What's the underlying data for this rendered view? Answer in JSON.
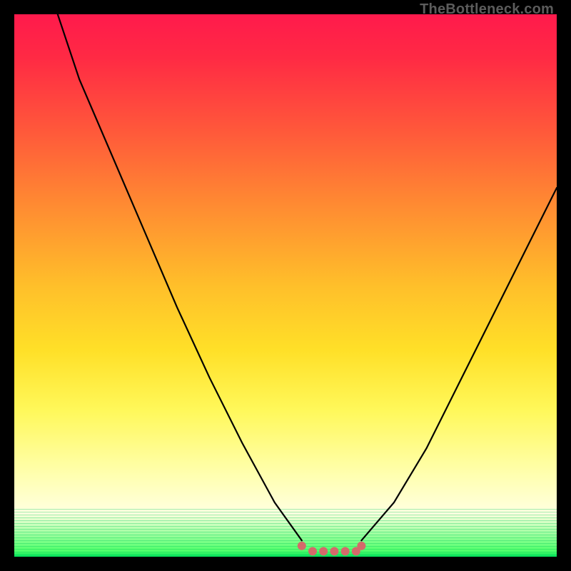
{
  "watermark": "TheBottleneck.com",
  "colors": {
    "background": "#000000",
    "curve": "#000000",
    "dots": "#d46a6a",
    "gradient_top": "#ff1a4c",
    "gradient_bottom": "#00e05a"
  },
  "chart_data": {
    "type": "line",
    "title": "",
    "xlabel": "",
    "ylabel": "",
    "xlim": [
      0,
      100
    ],
    "ylim": [
      0,
      100
    ],
    "series": [
      {
        "name": "left-branch",
        "x": [
          8,
          12,
          18,
          24,
          30,
          36,
          42,
          48,
          53
        ],
        "y": [
          100,
          88,
          74,
          60,
          46,
          33,
          21,
          10,
          3
        ]
      },
      {
        "name": "right-branch",
        "x": [
          64,
          70,
          76,
          82,
          88,
          94,
          100
        ],
        "y": [
          3,
          10,
          20,
          32,
          44,
          56,
          68
        ]
      },
      {
        "name": "bottom-dots",
        "x": [
          53,
          55,
          57,
          59,
          61,
          63,
          64
        ],
        "y": [
          2,
          1,
          1,
          1,
          1,
          1,
          2
        ]
      }
    ],
    "notes": "Values are approximate readings from an unlabeled bottleneck-style chart; x and y are in percent of the inner plot area (0–100)."
  }
}
